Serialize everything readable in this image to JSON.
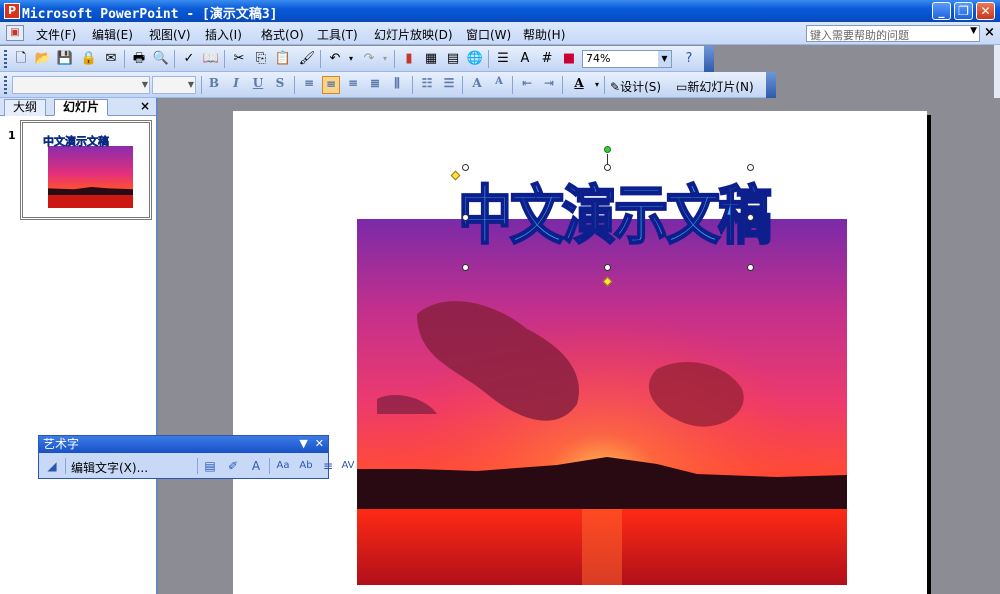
{
  "window": {
    "title": "Microsoft PowerPoint - [演示文稿3]",
    "minimize_glyph": "_",
    "restore_glyph": "❐",
    "close_glyph": "✕"
  },
  "menu": {
    "items": [
      "文件(F)",
      "编辑(E)",
      "视图(V)",
      "插入(I)",
      "格式(O)",
      "工具(T)",
      "幻灯片放映(D)",
      "窗口(W)",
      "帮助(H)"
    ],
    "help_placeholder": "键入需要帮助的问题",
    "doc_close_glyph": "×"
  },
  "toolbar_standard": {
    "zoom": "74%"
  },
  "toolbar_format": {
    "font_name": "",
    "font_size": "",
    "design_label": "设计(S)",
    "new_slide_label": "新幻灯片(N)"
  },
  "left_panel": {
    "tab_outline": "大纲",
    "tab_slides": "幻灯片",
    "close_glyph": "×",
    "slide_number": "1",
    "thumb_text": "中文演示文稿"
  },
  "slide": {
    "wordart_text": "中文演示文稿"
  },
  "wordart_toolbar": {
    "title": "艺术字",
    "edit_text_label": "编辑文字(X)..."
  }
}
